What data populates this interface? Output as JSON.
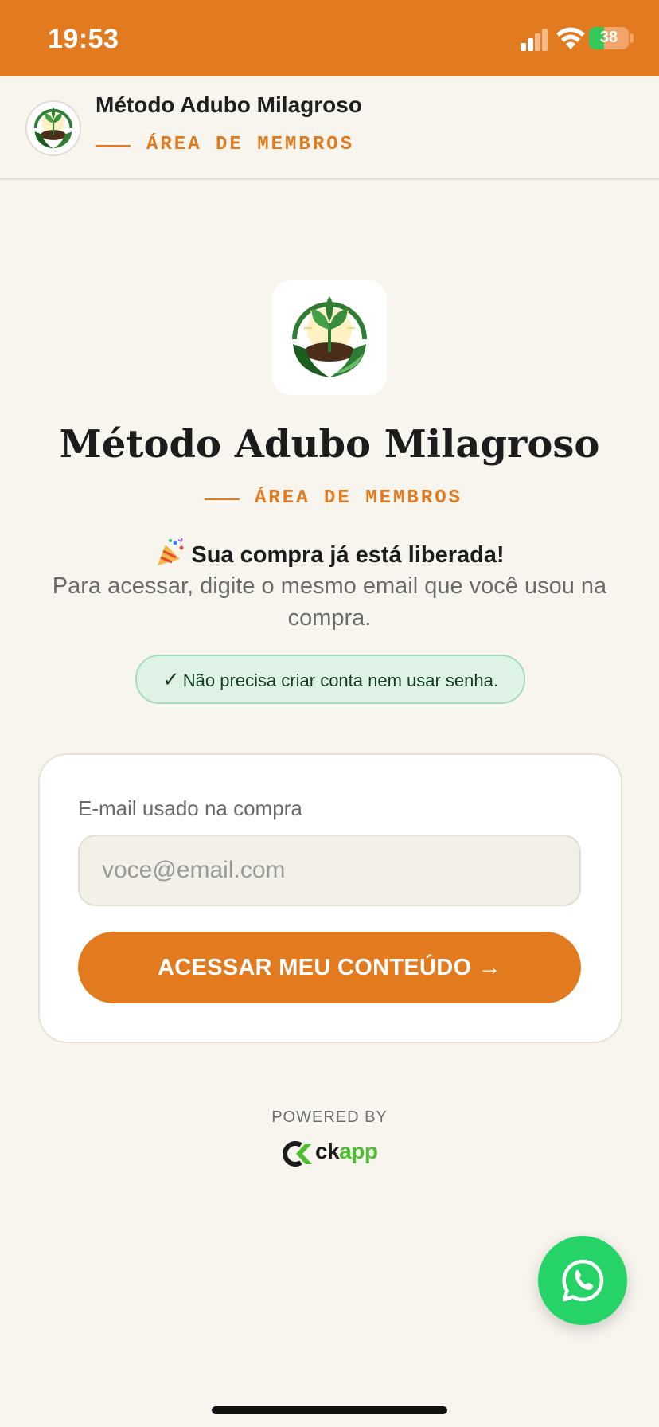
{
  "status_bar": {
    "time": "19:53",
    "battery_percent": "38",
    "icons": [
      "cellular-signal-icon",
      "wifi-icon",
      "battery-charging-icon"
    ]
  },
  "header": {
    "title": "Método Adubo Milagroso",
    "subtitle": "ÁREA DE MEMBROS",
    "logo_icon": "plant-in-hands-logo"
  },
  "hero": {
    "title": "Método Adubo Milagroso",
    "subtitle": "ÁREA DE MEMBROS",
    "release_text": "Sua compra já está liberada!",
    "release_icon": "party-popper-icon",
    "instructions": "Para acessar, digite o mesmo email que você usou na compra.",
    "notice": "Não precisa criar conta nem usar senha.",
    "notice_icon": "checkmark-icon"
  },
  "login": {
    "email_label": "E-mail usado na compra",
    "email_placeholder": "voce@email.com",
    "email_value": "",
    "submit_label": "ACESSAR MEU CONTEÚDO →"
  },
  "footer": {
    "powered_by": "POWERED BY",
    "brand_prefix": "ck",
    "brand_suffix": "app"
  },
  "fab": {
    "icon": "whatsapp-icon"
  },
  "colors": {
    "accent": "#e27a1f",
    "background": "#f8f5ef",
    "success_bg": "#dff2e6",
    "whatsapp": "#25d366"
  }
}
